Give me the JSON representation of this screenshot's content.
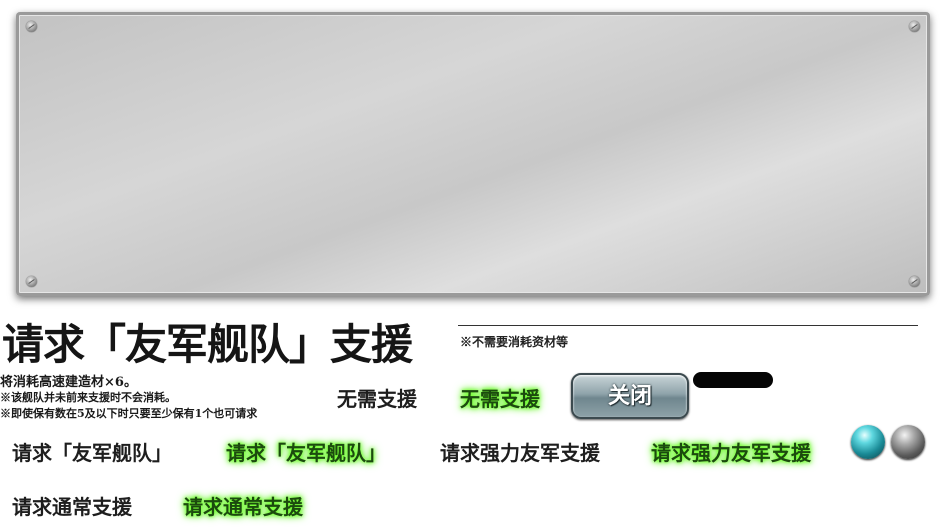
{
  "title": "请求「友军舰队」支援",
  "note_top": "※不需要消耗资材等",
  "info_lines": [
    "将消耗高速建造材×6。",
    "※该舰队并未前来支援时不会消耗。",
    "※即使保有数在5及以下时只要至少保有1个也可请求"
  ],
  "buttons": {
    "no_support": "无需支援",
    "no_support_hover": "无需支援",
    "close": "关闭",
    "request_fleet": "请求「友军舰队」",
    "request_fleet_hover": "请求「友军舰队」",
    "request_strong": "请求强力友军支援",
    "request_strong_hover": "请求强力友军支援",
    "request_normal": "请求通常支援",
    "request_normal_hover": "请求通常支援"
  },
  "colors": {
    "glow": "#66ff22",
    "close_button": "#8fa3aa",
    "orb_active": "#1a8a96",
    "orb_inactive": "#5a5a5a"
  },
  "icons": [
    "bolt-icon",
    "teal-orb-icon",
    "gray-orb-icon"
  ]
}
